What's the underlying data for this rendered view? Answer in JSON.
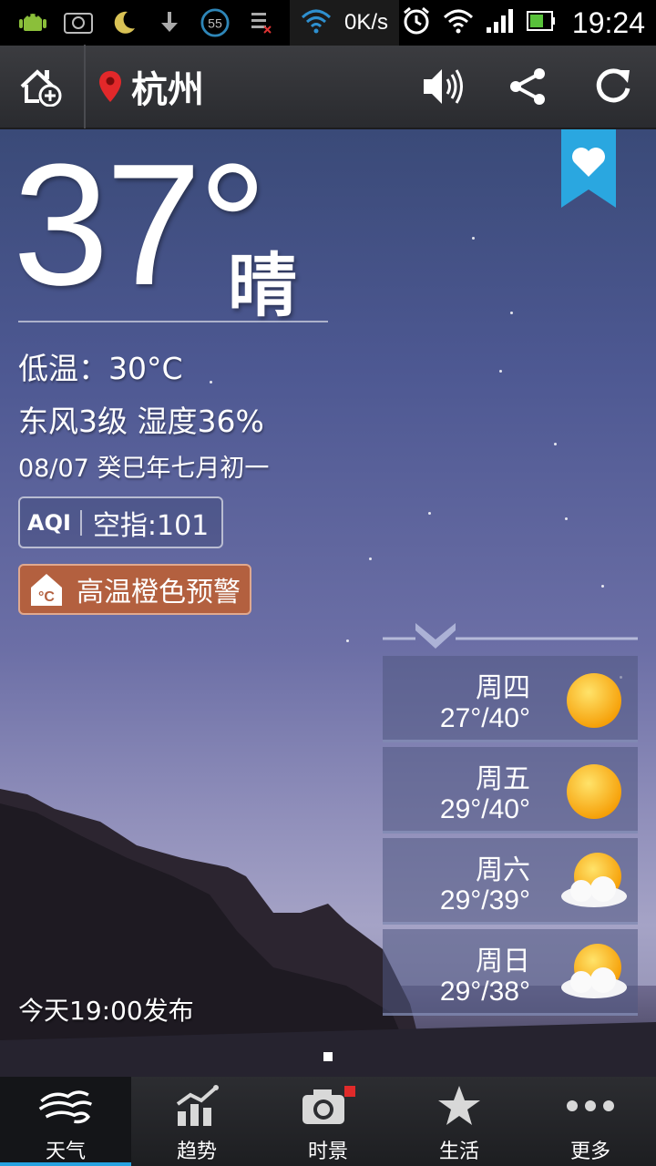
{
  "status_bar": {
    "net_speed": "0K/s",
    "time": "19:24",
    "badge_number": "55",
    "icons": [
      "android-debug-icon",
      "screenshot-icon",
      "moon-icon",
      "download-icon",
      "timer-badge-icon",
      "sim-icon",
      "wifi-icon",
      "alarm-icon",
      "wifi-icon",
      "signal-icon",
      "battery-icon"
    ]
  },
  "header": {
    "city": "杭州",
    "icons": [
      "add-city-icon",
      "location-pin-icon",
      "speaker-icon",
      "share-icon",
      "refresh-icon"
    ]
  },
  "current": {
    "temperature": "37°",
    "condition": "晴",
    "low_temp": "低温：30°C",
    "wind_humidity": "东风3级 湿度36%",
    "date_lunar": "08/07 癸巳年七月初一",
    "aqi_tag": "AQI",
    "aqi_value": "空指:101",
    "alert_text": "高温橙色预警",
    "published": "今天19:00发布"
  },
  "forecast": [
    {
      "day": "周四",
      "range": "27°/40°",
      "icon": "sunny-icon"
    },
    {
      "day": "周五",
      "range": "29°/40°",
      "icon": "sunny-icon"
    },
    {
      "day": "周六",
      "range": "29°/39°",
      "icon": "partly-cloudy-icon"
    },
    {
      "day": "周日",
      "range": "29°/38°",
      "icon": "partly-cloudy-icon"
    }
  ],
  "tabs": [
    {
      "label": "天气",
      "icon": "weather-icon",
      "active": true
    },
    {
      "label": "趋势",
      "icon": "trend-icon",
      "active": false
    },
    {
      "label": "时景",
      "icon": "camera-icon",
      "active": false
    },
    {
      "label": "生活",
      "icon": "star-icon",
      "active": false
    },
    {
      "label": "更多",
      "icon": "more-icon",
      "active": false
    }
  ],
  "colors": {
    "accent": "#27a2e0",
    "alert_bg": "#b3603f",
    "sun": "#f5a300"
  }
}
